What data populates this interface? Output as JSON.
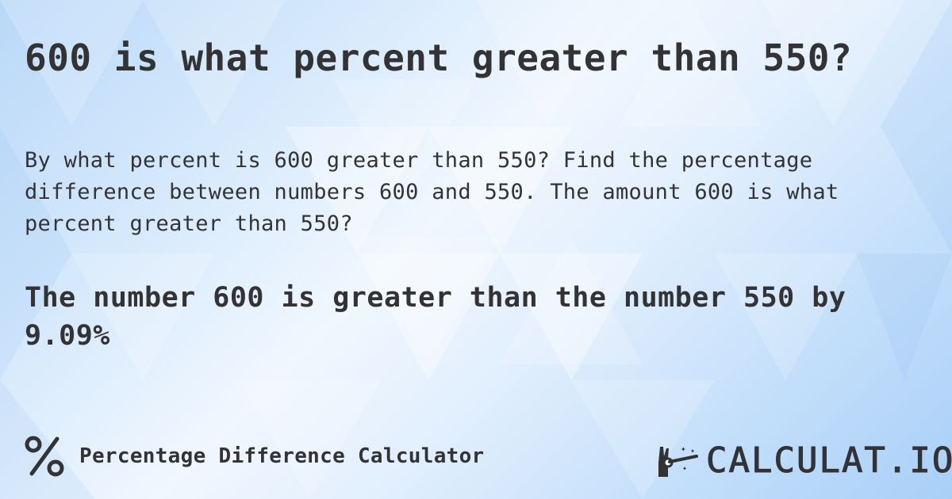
{
  "title": "600 is what percent greater than 550?",
  "description": "By what percent is 600 greater than 550? Find the percentage difference between numbers 600 and 550. The amount 600 is what percent greater than 550?",
  "answer": {
    "text": "The number 600 is greater than the number 550 by 9.09%",
    "value": 600,
    "base": 550,
    "percent_difference": "9.09%"
  },
  "footer": {
    "calculator_icon": "percent-icon",
    "calculator_name": "Percentage Difference Calculator",
    "brand_icon": "magic-wand-hand-icon",
    "brand_name": "CALCULAT.IO"
  },
  "colors": {
    "text": "#333336",
    "background_light": "#f0f7fe",
    "background_blue": "#a9cff7"
  }
}
